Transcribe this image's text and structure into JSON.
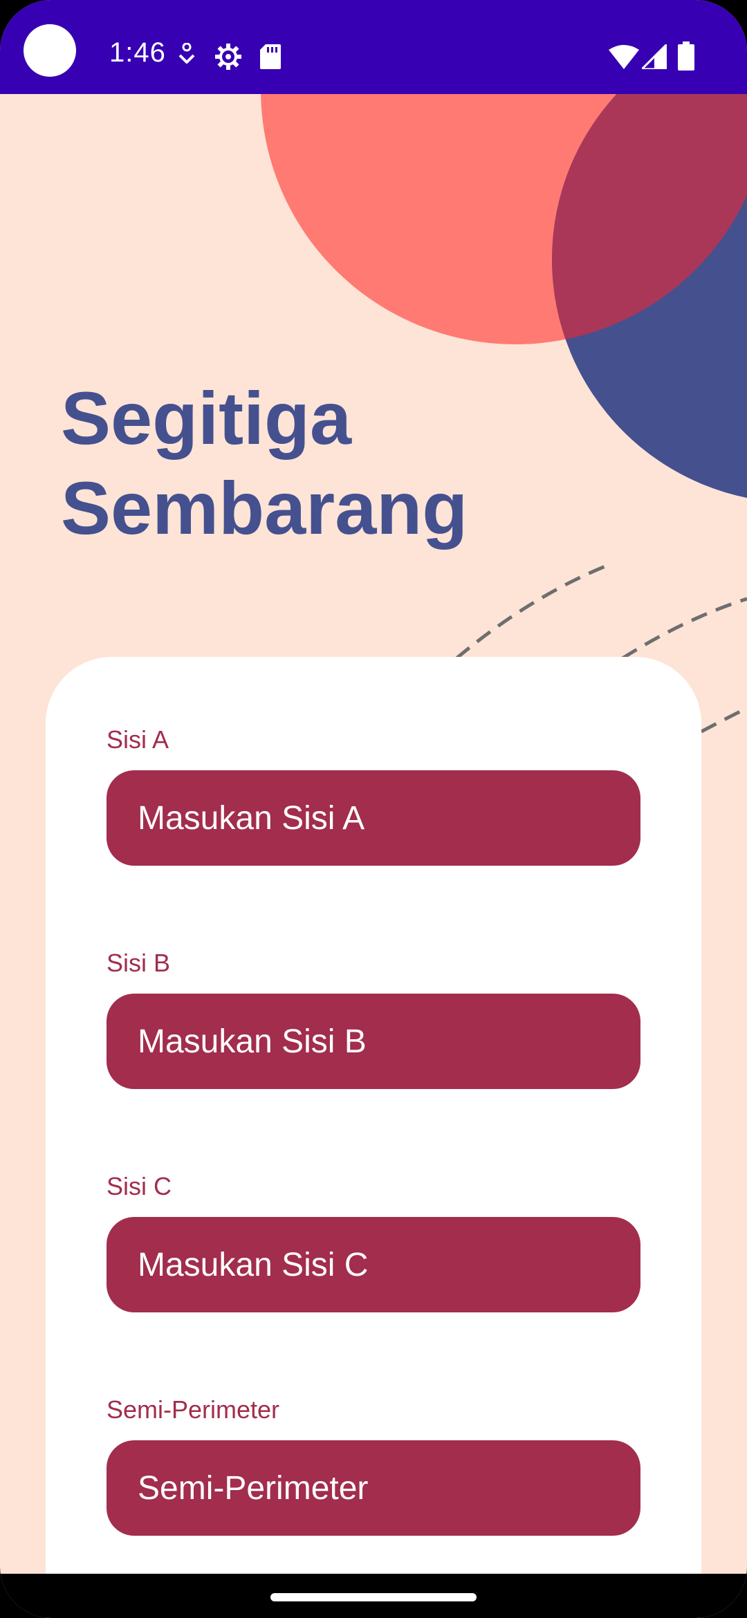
{
  "status_bar": {
    "time": "1:46",
    "icons": [
      "navigation-icon",
      "settings-gear-icon",
      "sd-card-icon",
      "wifi-icon",
      "cell-signal-icon",
      "battery-icon"
    ]
  },
  "page": {
    "title_line1": "Segitiga",
    "title_line2": "Sembarang"
  },
  "form": {
    "fields": [
      {
        "label": "Sisi A",
        "placeholder": "Masukan Sisi A"
      },
      {
        "label": "Sisi B",
        "placeholder": "Masukan Sisi B"
      },
      {
        "label": "Sisi C",
        "placeholder": "Masukan Sisi C"
      },
      {
        "label": "Semi-Perimeter",
        "placeholder": "Semi-Perimeter"
      }
    ]
  },
  "colors": {
    "status_bar": "#3700b3",
    "background": "#fde4d6",
    "salmon_circle": "#ff7a73",
    "navy_circle": "#45508f",
    "overlap": "#aa3757",
    "title": "#45508f",
    "accent": "#a22d4c",
    "card": "#ffffff"
  }
}
